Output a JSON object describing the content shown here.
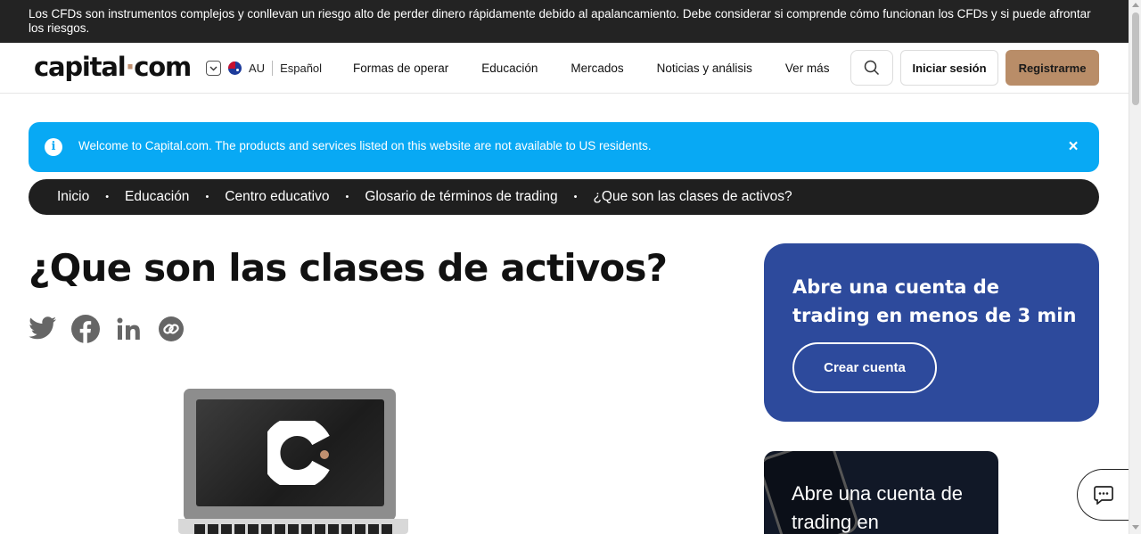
{
  "risk_banner": {
    "text": "Los CFDs son instrumentos complejos y conllevan un riesgo alto de perder dinero rápidamente debido al apalancamiento. Debe considerar si comprende cómo funcionan los CFDs y si puede afrontar los riesgos."
  },
  "header": {
    "logo_left": "capital",
    "logo_dot": "·",
    "logo_right": "com",
    "region_code": "AU",
    "language": "Español",
    "nav": [
      "Formas de operar",
      "Educación",
      "Mercados",
      "Noticias y análisis",
      "Ver más"
    ],
    "login_label": "Iniciar sesión",
    "signup_label": "Registrarme"
  },
  "alert": {
    "message": "Welcome to Capital.com. The products and services listed on this website are not available to US residents.",
    "close_symbol": "×"
  },
  "breadcrumb": [
    "Inicio",
    "Educación",
    "Centro educativo",
    "Glosario de términos de trading",
    "¿Que son las clases de activos?"
  ],
  "breadcrumb_separator": "•",
  "page": {
    "title": "¿Que son las clases de activos?"
  },
  "share_icons": [
    "twitter-icon",
    "facebook-icon",
    "linkedin-icon",
    "copy-link-icon"
  ],
  "promo": {
    "heading": "Abre una cuenta de trading en menos de 3 min",
    "button_label": "Crear cuenta"
  },
  "app_card": {
    "heading": "Abre una cuenta de trading en"
  },
  "colors": {
    "risk_bar": "#232323",
    "alert_blue": "#08a9f4",
    "signup_brown": "#b98d68",
    "promo_blue": "#2d4a9c",
    "breadcrumb_bg": "#1f1f1f"
  }
}
